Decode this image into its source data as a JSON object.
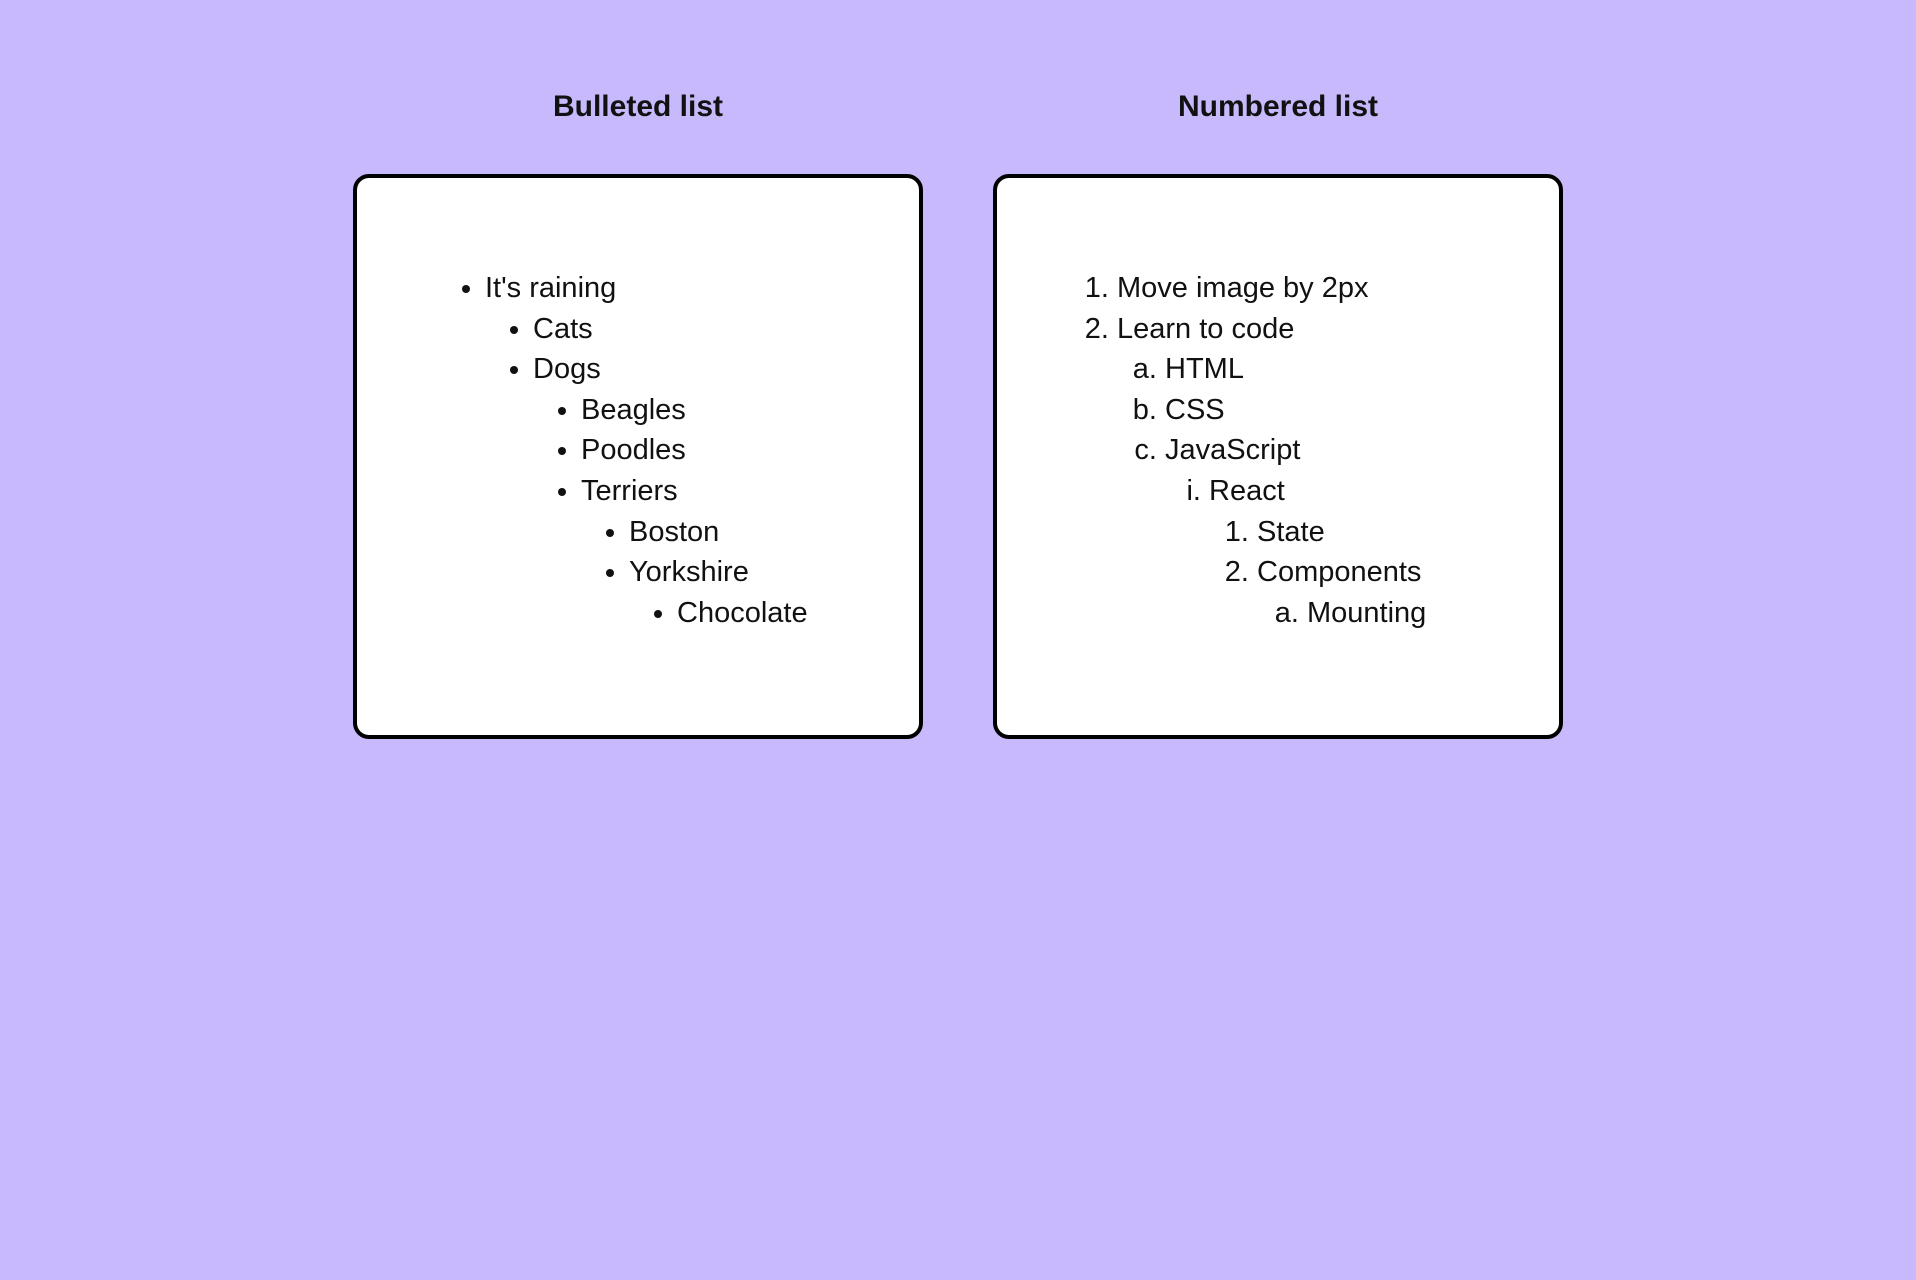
{
  "left": {
    "heading": "Bulleted list",
    "items": {
      "root": "It's raining",
      "cats": "Cats",
      "dogs": "Dogs",
      "beagles": "Beagles",
      "poodles": "Poodles",
      "terriers": "Terriers",
      "boston": "Boston",
      "yorkshire": "Yorkshire",
      "chocolate": "Chocolate"
    }
  },
  "right": {
    "heading": "Numbered list",
    "items": {
      "move_image": "Move image by 2px",
      "learn_code": "Learn to code",
      "html": "HTML",
      "css": "CSS",
      "javascript": "JavaScript",
      "react": "React",
      "state": "State",
      "components": "Components",
      "mounting": "Mounting"
    }
  }
}
